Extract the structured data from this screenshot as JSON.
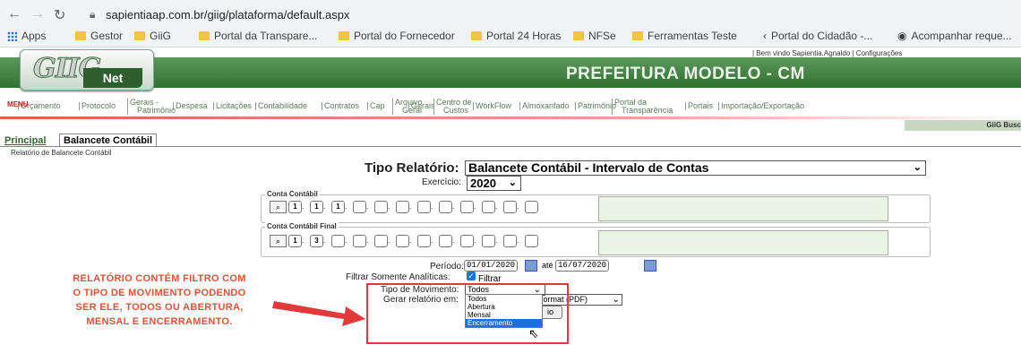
{
  "browser": {
    "url": "sapientiaap.com.br/giig/plataforma/default.aspx",
    "bookmarks": [
      "Apps",
      "Gestor",
      "GiiG",
      "Portal da Transpare...",
      "Portal do Fornecedor",
      "Portal 24 Horas",
      "NFSe",
      "Ferramentas Teste",
      "Portal do Cidadão -...",
      "Acompanhar reque..."
    ]
  },
  "header": {
    "welcome": "| Bem vindo Sapientia.Agnaldo   |  Configurações",
    "logo_giig": "GIIG",
    "logo_net": "Net",
    "title": "PREFEITURA MODELO - CM",
    "giig_busca": "GiiG Busc"
  },
  "menu": {
    "label": "MENU",
    "items": [
      {
        "label": "Orçamento",
        "sub": ""
      },
      {
        "label": "Protocolo",
        "sub": ""
      },
      {
        "label": "Gerais -",
        "sub": "Patrimônio"
      },
      {
        "label": "Despesa",
        "sub": ""
      },
      {
        "label": "Licitações",
        "sub": ""
      },
      {
        "label": "Contabilidade",
        "sub": ""
      },
      {
        "label": "Contratos",
        "sub": ""
      },
      {
        "label": "Cap",
        "sub": ""
      },
      {
        "label": "Arquivo",
        "sub": "Geral"
      },
      {
        "label": "Gerais",
        "sub": ""
      },
      {
        "label": "Centro de",
        "sub": "Custos"
      },
      {
        "label": "WorkFlow",
        "sub": ""
      },
      {
        "label": "Almoxarifado",
        "sub": ""
      },
      {
        "label": "Patrimônio",
        "sub": ""
      },
      {
        "label": "Portal da",
        "sub": "Transparência"
      },
      {
        "label": "Portais",
        "sub": ""
      },
      {
        "label": "Importação/Exportação",
        "sub": ""
      }
    ]
  },
  "tabs": {
    "principal": "Principal",
    "balancete": "Balancete Contábil"
  },
  "subtitle": "Relatório de Balancete Contábil",
  "form": {
    "tipo_label": "Tipo Relatório:",
    "tipo_value": "Balancete Contábil - Intervalo de Contas",
    "exercicio_label": "Exercício:",
    "exercicio_value": "2020",
    "conta_label": "Conta Contábil",
    "conta_segments": [
      "1",
      "1",
      "1",
      "",
      "",
      "",
      "",
      "",
      "",
      "",
      "",
      ""
    ],
    "conta_final_label": "Conta Contábil Final",
    "conta_final_segments": [
      "1",
      "3",
      "",
      "",
      "",
      "",
      "",
      "",
      "",
      "",
      "",
      ""
    ],
    "periodo_label": "Período:",
    "data_inicio": "01/01/2020",
    "ate": "até",
    "data_fim": "16/07/2020",
    "filtrar_label": "Filtrar Somente Analíticas:",
    "filtrar_text": "Filtrar",
    "tipo_mov_label": "Tipo de Movimento:",
    "tipo_mov_value": "Todos",
    "tipo_mov_options": [
      "Todos",
      "Abertura",
      "Mensal",
      "Encerramento"
    ],
    "gerar_label": "Gerar relatório em:",
    "gerar_value": "t Format (PDF)",
    "gerar_button": "io"
  },
  "annotation": "RELATÓRIO CONTÉM FILTRO COM O TIPO DE MOVIMENTO PODENDO SER ELE, TODOS OU ABERTURA, MENSAL E ENCERRAMENTO.",
  "colors": {
    "accent_red": "#e23a3a",
    "banner_green": "#2f6f2f",
    "select_blue": "#1e6fd9"
  }
}
